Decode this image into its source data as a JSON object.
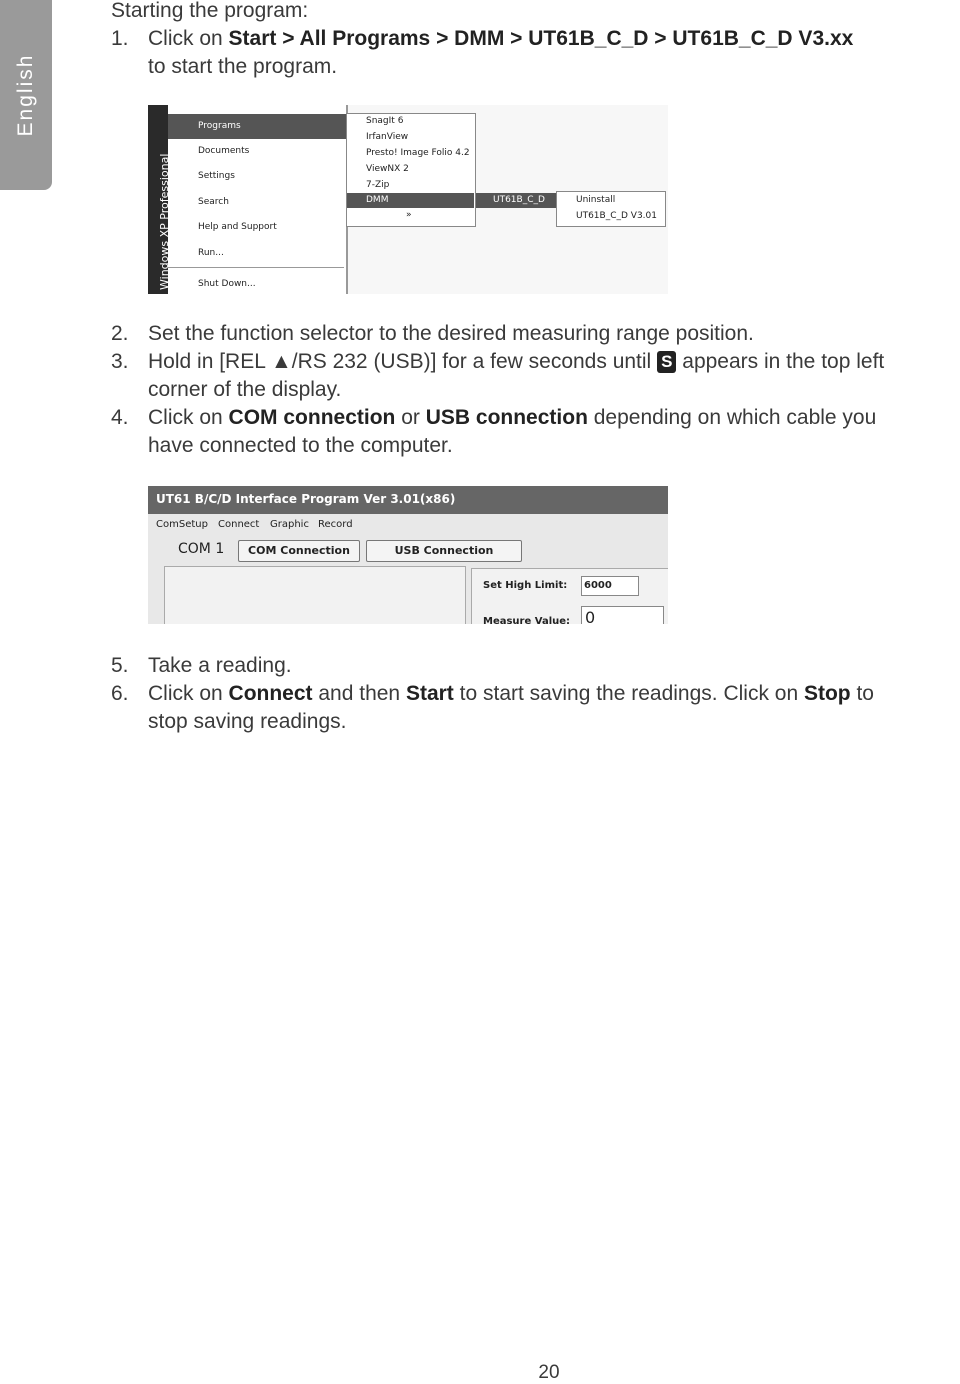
{
  "side_tab": "English",
  "heading": "Starting the program:",
  "steps": [
    {
      "n": "1.",
      "parts": [
        "Click on ",
        "Start > All Programs > DMM > UT61B_C_D > UT61B_C_D V3.xx"
      ],
      "cont": "to start the program."
    },
    {
      "n": "2.",
      "text": "Set the function selector to the desired measuring range position."
    },
    {
      "n": "3.",
      "pre": "Hold in [REL ▲/RS 232 (USB)] for a few seconds until",
      "badge": "S",
      "post": "appears in the top left",
      "cont": "corner of the display."
    },
    {
      "n": "4.",
      "parts": [
        "Click on ",
        "COM connection",
        " or ",
        "USB connection",
        " depending on which cable you"
      ],
      "cont": "have connected to the computer."
    },
    {
      "n": "5.",
      "text": "Take a reading."
    },
    {
      "n": "6.",
      "parts": [
        "Click on ",
        "Connect",
        " and then ",
        "Start",
        " to start saving the readings. Click on ",
        "Stop",
        " to"
      ],
      "cont": "stop saving readings."
    }
  ],
  "startmenu": {
    "sidebar": "Windows XP Professional",
    "items": [
      "Programs",
      "Documents",
      "Settings",
      "Search",
      "Help and Support",
      "Run...",
      "Shut Down..."
    ],
    "programs": [
      "SnagIt 6",
      "IrfanView",
      "Presto! Image Folio 4.2",
      "ViewNX 2",
      "7-Zip",
      "DMM",
      "»"
    ],
    "dmm": [
      "UT61B_C_D"
    ],
    "ut61": [
      "Uninstall",
      "UT61B_C_D V3.01"
    ]
  },
  "app": {
    "title": "UT61 B/C/D Interface Program Ver 3.01(x86)",
    "menu": [
      "ComSetup",
      "Connect",
      "Graphic",
      "Record"
    ],
    "port": "COM 1",
    "com_btn": "COM Connection",
    "usb_btn": "USB Connection",
    "high_limit_label": "Set High Limit:",
    "high_limit_value": "6000",
    "measure_label": "Measure Value:",
    "measure_value": "0"
  },
  "page_number": "20"
}
